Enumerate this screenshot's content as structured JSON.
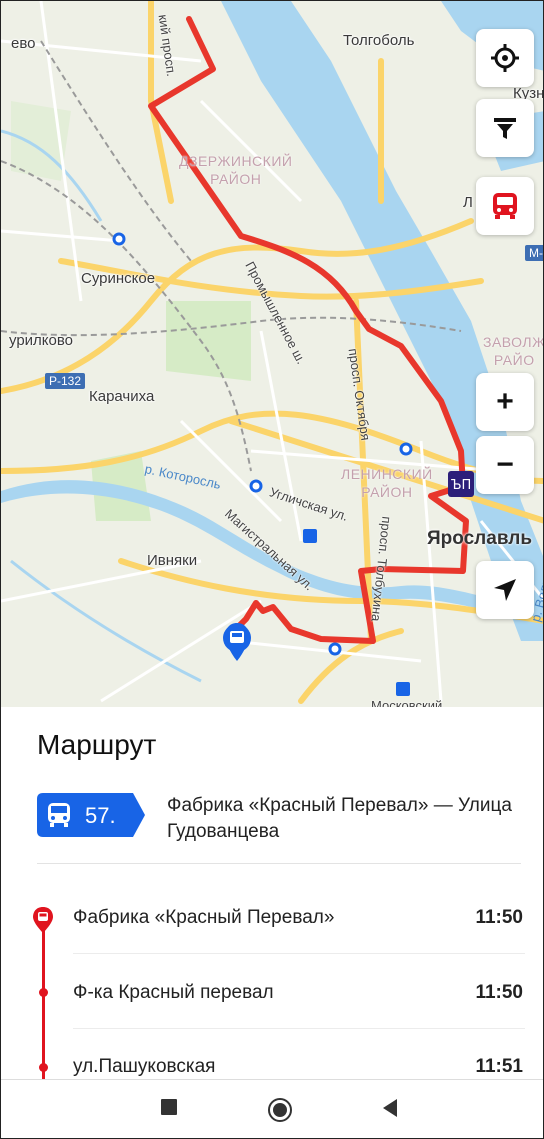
{
  "map": {
    "place_labels": {
      "tolgobol": "Толгоболь",
      "kuz": "Кузн",
      "evo": "ево",
      "surinskoe": "Суринское",
      "urilkovo": "урилково",
      "karachikha": "Карачиха",
      "ivnyaki": "Ивняки",
      "l_label": "Л",
      "m_label": "М-",
      "yaroslavl": "Ярославль"
    },
    "districts": {
      "dzerzhinsky": "ДЗЕРЖИНСКИЙ\nРАЙОН",
      "leninsky": "ЛЕНИНСКИЙ\nРАЙОН",
      "zavolzh": "ЗАВОЛЖ\nРАЙО"
    },
    "road_badge": "Р-132",
    "street_labels": {
      "prom_sh": "Промышленное ш.",
      "pr_oktyabrya": "просп. Октября",
      "uglichskaya": "Угличская ул.",
      "magistralnaya": "Магистральная ул.",
      "pr_tolbukhina": "просп. Толбухина",
      "kiy_prosp": "кий просп.",
      "moskovsky": "Московский",
      "kotorosl": "р. Которосль",
      "volga": "р. Волга"
    },
    "controls": {
      "locate_icon": "crosshair-icon",
      "filter_icon": "filter-icon",
      "transport_icon": "bus-icon",
      "zoom_in": "+",
      "zoom_out": "−",
      "navigate_icon": "navigation-arrow-icon"
    },
    "colors": {
      "route": "#e8372c",
      "water": "#a9d5f0",
      "land": "#eef0e6",
      "road": "#fbd46a",
      "bus_marker": "#1864e6",
      "stop_marker": "#2c1f7a"
    }
  },
  "sheet": {
    "title": "Маршрут",
    "route_number": "57.",
    "route_desc": "Фабрика «Красный Перевал» — Улица Гудованцева",
    "stops": [
      {
        "name": "Фабрика «Красный Перевал»",
        "time": "11:50"
      },
      {
        "name": "Ф-ка Красный перевал",
        "time": "11:50"
      },
      {
        "name": "ул.Пашуковская",
        "time": "11:51"
      }
    ],
    "line_color": "#e0141f"
  },
  "navbar": {
    "recent_icon": "square-icon",
    "home_icon": "circle-icon",
    "back_icon": "triangle-back-icon"
  }
}
